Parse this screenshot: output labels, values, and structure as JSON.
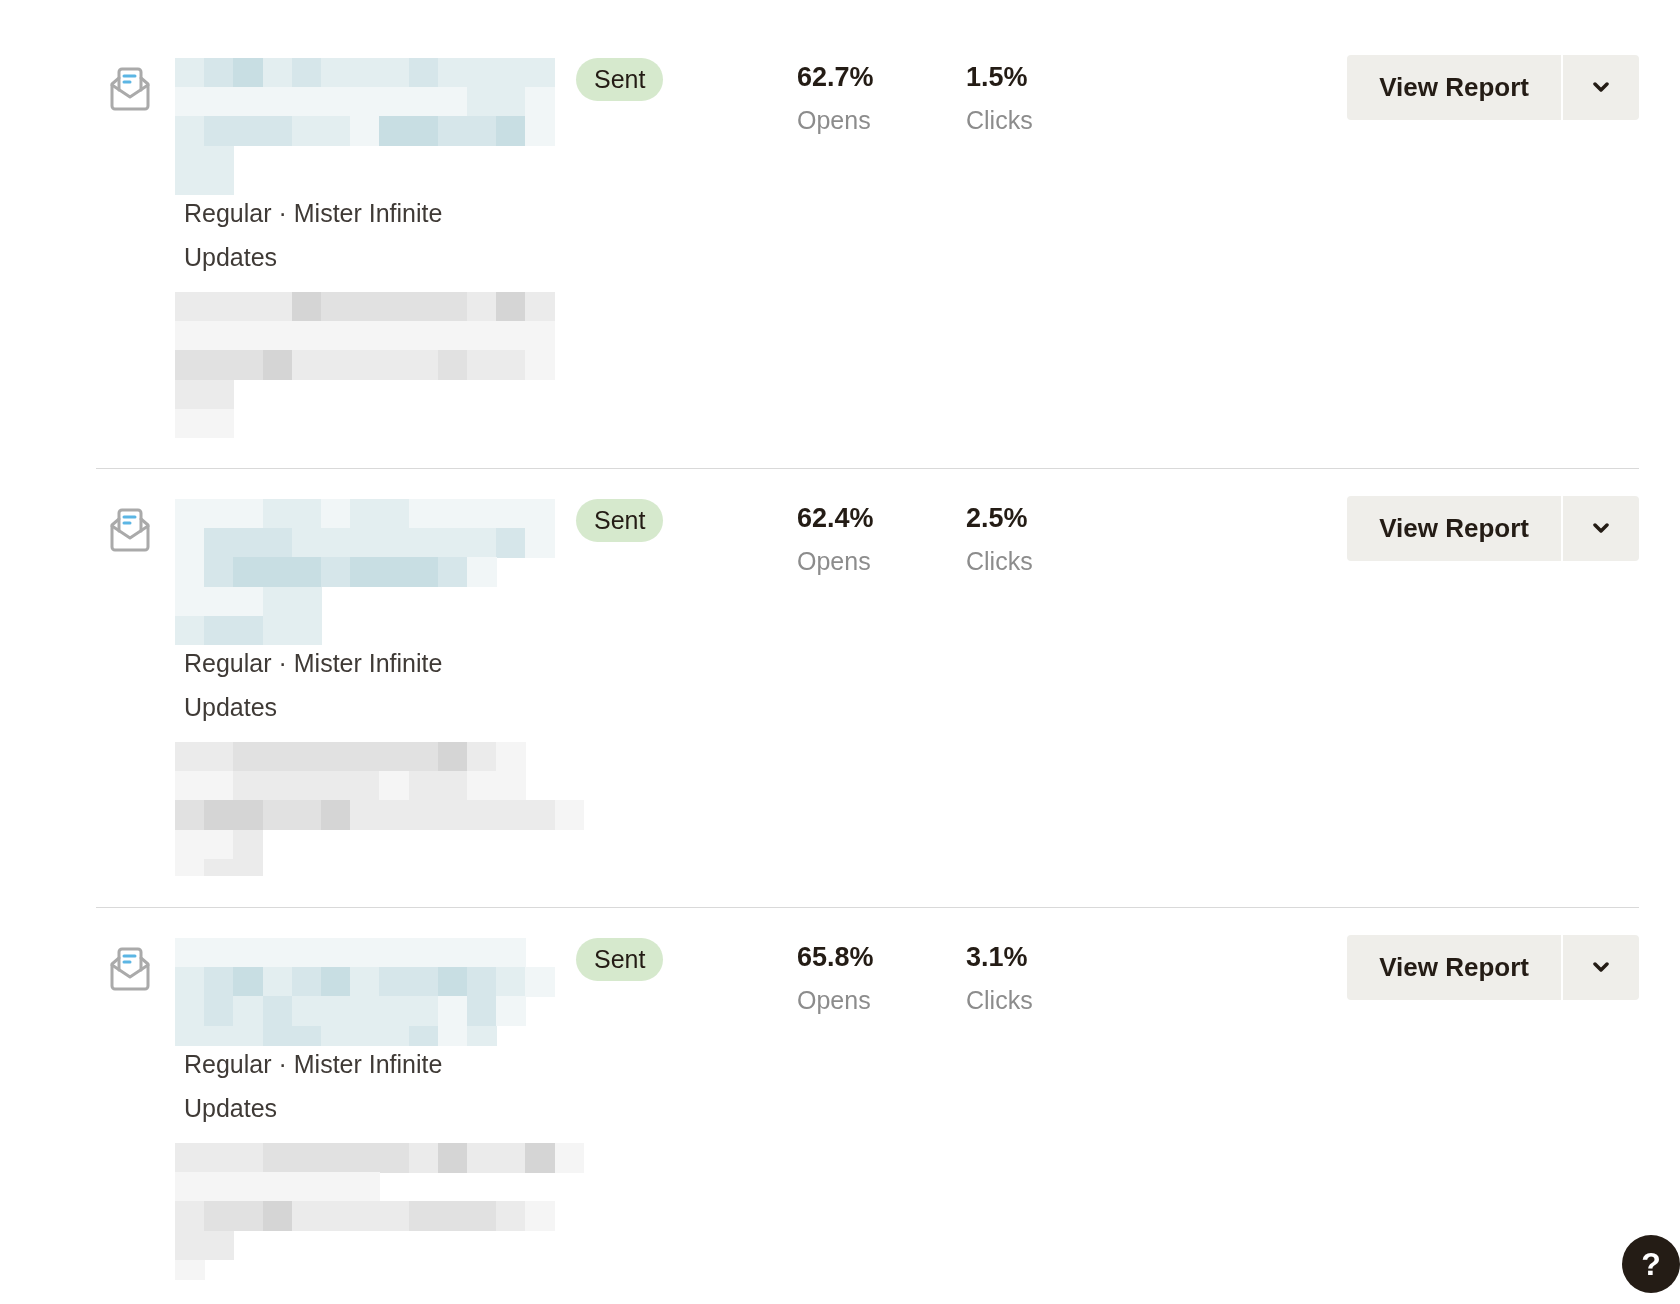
{
  "campaigns": [
    {
      "status": "Sent",
      "meta": "Regular · Mister Infinite Updates",
      "stats": [
        {
          "value": "62.7%",
          "label": "Opens"
        },
        {
          "value": "1.5%",
          "label": "Clicks"
        }
      ],
      "action": "View Report"
    },
    {
      "status": "Sent",
      "meta": "Regular · Mister Infinite Updates",
      "stats": [
        {
          "value": "62.4%",
          "label": "Opens"
        },
        {
          "value": "2.5%",
          "label": "Clicks"
        }
      ],
      "action": "View Report"
    },
    {
      "status": "Sent",
      "meta": "Regular · Mister Infinite Updates",
      "stats": [
        {
          "value": "65.8%",
          "label": "Opens"
        },
        {
          "value": "3.1%",
          "label": "Clicks"
        }
      ],
      "action": "View Report"
    }
  ],
  "help_button": {
    "label": "?"
  }
}
